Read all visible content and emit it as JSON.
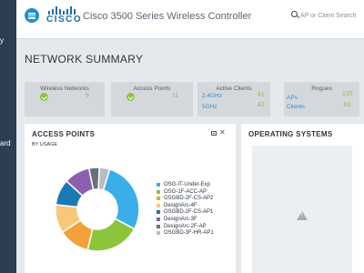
{
  "sidebar": {
    "frag_top": "y",
    "frag_bottom": "ard"
  },
  "header": {
    "logo_text": "CISCO",
    "title": "Cisco 3500 Series Wireless Controller",
    "search_placeholder": "AP or Client Search"
  },
  "page_title": "NETWORK SUMMARY",
  "summary": {
    "wireless_networks": {
      "label": "Wireless Networks",
      "value": "9"
    },
    "access_points": {
      "label": "Access Points",
      "value": "11"
    },
    "active_clients": {
      "label": "Active Clients",
      "rows": [
        {
          "label": "2.4GHz",
          "value": "41"
        },
        {
          "label": "5GHz",
          "value": "42"
        }
      ]
    },
    "rogues": {
      "label": "Rogues",
      "rows": [
        {
          "label": "APs",
          "value": "133"
        },
        {
          "label": "Clients",
          "value": "61"
        }
      ]
    }
  },
  "access_points_panel": {
    "title": "ACCESS POINTS",
    "subtitle": "BY USAGE",
    "legend": [
      {
        "name": "OSG-IT-Under-Exp",
        "color": "#3aaee8"
      },
      {
        "name": "OSG-1F-ACC-AP",
        "color": "#8cc43c"
      },
      {
        "name": "OSGBD-2F-CS-AP2",
        "color": "#f2a13a"
      },
      {
        "name": "DesignArc-4F",
        "color": "#f9c77a"
      },
      {
        "name": "OSGBD-2F-CS-AP1",
        "color": "#1b79b5"
      },
      {
        "name": "DesignArc-3F",
        "color": "#8e5fb0"
      },
      {
        "name": "DesignArc-2F-AP",
        "color": "#667078"
      },
      {
        "name": "OSGBD-3F-HR-AP1",
        "color": "#b8bdc2"
      }
    ]
  },
  "chart_data": {
    "type": "pie",
    "title": "ACCESS POINTS",
    "subtitle": "BY USAGE",
    "categories": [
      "OSG-IT-Under-Exp",
      "OSG-1F-ACC-AP",
      "OSGBD-2F-CS-AP2",
      "DesignArc-4F",
      "OSGBD-2F-CS-AP1",
      "DesignArc-3F",
      "DesignArc-2F-AP",
      "OSGBD-3F-HR-AP1"
    ],
    "values": [
      28,
      21,
      12,
      11,
      10,
      10,
      4,
      4
    ],
    "colors": [
      "#3aaee8",
      "#8cc43c",
      "#f2a13a",
      "#f9c77a",
      "#1b79b5",
      "#8e5fb0",
      "#667078",
      "#b8bdc2"
    ],
    "legend_position": "right"
  },
  "os_panel": {
    "title": "OPERATING SYSTEMS"
  }
}
